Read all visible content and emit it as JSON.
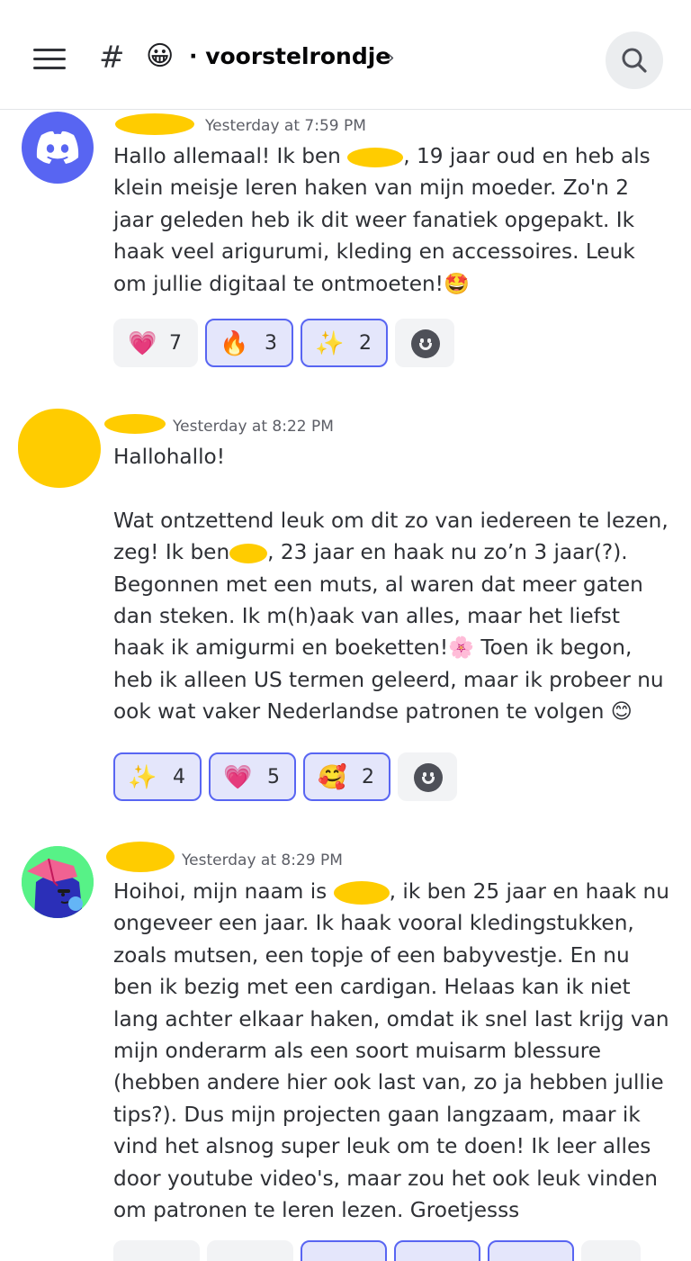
{
  "header": {
    "menu_icon": "hamburger-menu-icon",
    "hash": "#",
    "channel_emoji": "😀",
    "channel_name": "· voorstelrondje",
    "chevron": "›",
    "search_icon": "search-icon"
  },
  "messages": [
    {
      "timestamp": "Yesterday at 7:59 PM",
      "avatar": "discord-logo",
      "text_parts": [
        "Hallo allemaal! Ik ben ",
        ", 19 jaar oud en heb als klein meisje leren haken van mijn moeder. Zo'n 2 jaar geleden heb ik dit weer fanatiek opgepakt. Ik haak veel arigurumi, kleding en accessoires. Leuk om jullie digitaal te ontmoeten!🤩"
      ],
      "reactions": [
        {
          "emoji": "💗",
          "count": "7",
          "me": false
        },
        {
          "emoji": "🔥",
          "count": "3",
          "me": true
        },
        {
          "emoji": "✨",
          "count": "2",
          "me": true
        }
      ]
    },
    {
      "timestamp": "Yesterday at 8:22 PM",
      "avatar": "redacted-avatar",
      "line1": "Hallohallo!",
      "text_parts": [
        "Wat ontzettend leuk om dit zo van iedereen te lezen, zeg! Ik ben",
        ", 23 jaar en haak nu zo’n 3 jaar(?). Begonnen met een muts, al waren dat meer gaten dan steken. Ik m(h)aak van alles, maar het liefst haak ik amigurmi en boeketten!🌸 Toen ik begon, heb ik alleen US termen geleerd, maar ik probeer nu ook wat vaker Nederlandse patronen te volgen 😊"
      ],
      "reactions": [
        {
          "emoji": "✨",
          "count": "4",
          "me": true
        },
        {
          "emoji": "💗",
          "count": "5",
          "me": true
        },
        {
          "emoji": "🥰",
          "count": "2",
          "me": true
        }
      ]
    },
    {
      "timestamp": "Yesterday at 8:29 PM",
      "avatar": "character-avatar",
      "text_parts": [
        "Hoihoi, mijn naam is ",
        ", ik ben 25 jaar en haak nu ongeveer een jaar. Ik haak vooral kledingstukken, zoals mutsen, een topje of een babyvestje. En nu ben ik bezig met een cardigan. Helaas kan ik niet lang achter elkaar haken, omdat ik snel last krijg van mijn onderarm als een soort muisarm blessure (hebben andere hier ook last van, zo ja hebben jullie tips?). Dus mijn projecten gaan langzaam, maar ik vind het alsnog super leuk om te doen! Ik leer alles door youtube video's, maar zou het ook leuk vinden om patronen te leren lezen. Groetjesss"
      ]
    }
  ],
  "colors": {
    "blurple": "#5865f2",
    "redaction": "#ffcc00",
    "reaction_bg": "#f2f3f5",
    "reaction_me_bg": "#e4e6fb"
  }
}
